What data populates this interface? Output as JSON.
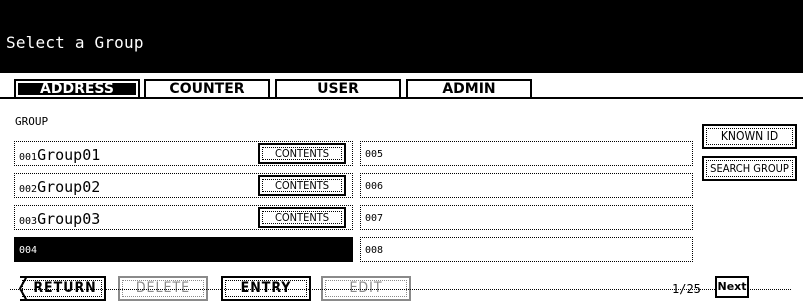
{
  "header": {
    "title": "Select a Group"
  },
  "tabs": [
    {
      "label": "ADDRESS",
      "active": true
    },
    {
      "label": "COUNTER",
      "active": false
    },
    {
      "label": "USER",
      "active": false
    },
    {
      "label": "ADMIN",
      "active": false
    }
  ],
  "group_label": "GROUP",
  "groups_left": [
    {
      "num": "001",
      "name": "Group01",
      "contents_label": "CONTENTS"
    },
    {
      "num": "002",
      "name": "Group02",
      "contents_label": "CONTENTS"
    },
    {
      "num": "003",
      "name": "Group03",
      "contents_label": "CONTENTS"
    },
    {
      "num": "004",
      "name": "",
      "selected": true
    }
  ],
  "groups_right": [
    {
      "num": "005"
    },
    {
      "num": "006"
    },
    {
      "num": "007"
    },
    {
      "num": "008"
    }
  ],
  "side_buttons": {
    "known_id": "KNOWN ID",
    "search_group": "SEARCH GROUP"
  },
  "bottom_bar": {
    "return_label": "RETURN",
    "delete_label": "DELETE",
    "entry_label": "ENTRY",
    "edit_label": "EDIT",
    "page_indicator": "1/25",
    "next_label": "Next"
  },
  "colors": {
    "header_bg": "#000000",
    "disabled": "#8a8a8a"
  }
}
